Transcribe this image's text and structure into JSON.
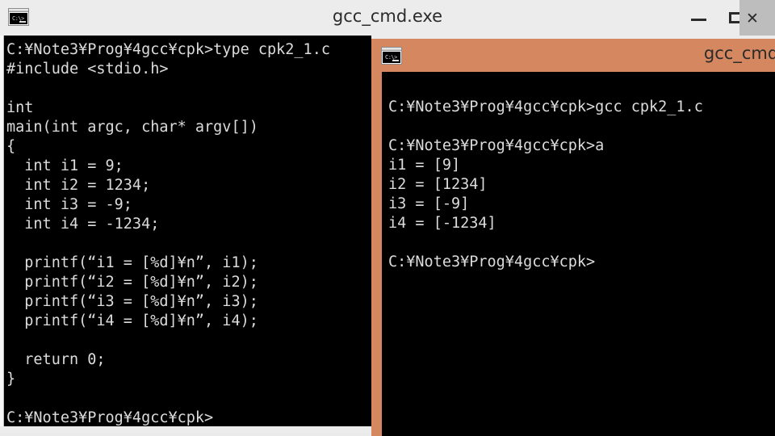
{
  "back_window": {
    "title": "gcc_cmd.exe",
    "icon": "console-icon",
    "buttons": {
      "minimize": "—",
      "maximize": "□",
      "close": "✕"
    },
    "console_lines": [
      "C:¥Note3¥Prog¥4gcc¥cpk>type cpk2_1.c",
      "#include <stdio.h>",
      "",
      "int",
      "main(int argc, char* argv[])",
      "{",
      "  int i1 = 9;",
      "  int i2 = 1234;",
      "  int i3 = -9;",
      "  int i4 = -1234;",
      "",
      "  printf(“i1 = [%d]¥n”, i1);",
      "  printf(“i2 = [%d]¥n”, i2);",
      "  printf(“i3 = [%d]¥n”, i3);",
      "  printf(“i4 = [%d]¥n”, i4);",
      "",
      "  return 0;",
      "}",
      "",
      "C:¥Note3¥Prog¥4gcc¥cpk>"
    ]
  },
  "front_window": {
    "title": "gcc_cmd.exe",
    "title_visible": "gcc_c",
    "icon": "console-icon",
    "accent_color": "#d58860",
    "console_lines": [
      "C:¥Note3¥Prog¥4gcc¥cpk>gcc cpk2_1.c",
      "",
      "C:¥Note3¥Prog¥4gcc¥cpk>a",
      "i1 = [9]",
      "i2 = [1234]",
      "i3 = [-9]",
      "i4 = [-1234]",
      "",
      "C:¥Note3¥Prog¥4gcc¥cpk>"
    ]
  },
  "desktop": {
    "background_color": "#eaeaea"
  }
}
